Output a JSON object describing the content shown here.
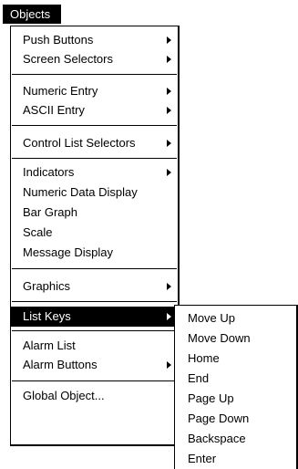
{
  "menubar": {
    "title": "Objects"
  },
  "menu": {
    "push_buttons": "Push Buttons",
    "screen_selectors": "Screen Selectors",
    "numeric_entry": "Numeric Entry",
    "ascii_entry": "ASCII Entry",
    "control_list_selectors": "Control List Selectors",
    "indicators": "Indicators",
    "numeric_data_display": "Numeric Data Display",
    "bar_graph": "Bar Graph",
    "scale": "Scale",
    "message_display": "Message Display",
    "graphics": "Graphics",
    "list_keys": "List Keys",
    "alarm_list": "Alarm List",
    "alarm_buttons": "Alarm Buttons",
    "global_object": "Global Object..."
  },
  "submenu": {
    "move_up": "Move Up",
    "move_down": "Move Down",
    "home": "Home",
    "end": "End",
    "page_up": "Page Up",
    "page_down": "Page Down",
    "backspace": "Backspace",
    "enter": "Enter"
  }
}
